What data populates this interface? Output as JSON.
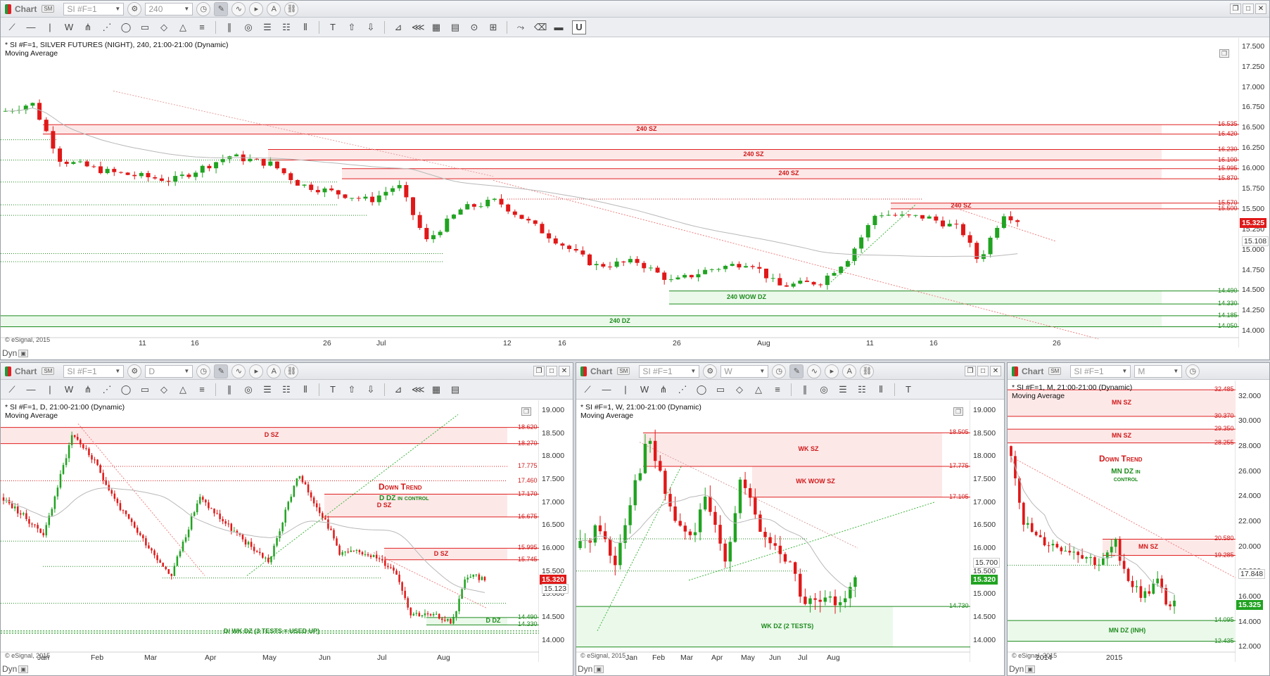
{
  "common": {
    "window_title": "Chart",
    "sync_label": "SM",
    "symbol": "SI #F=1",
    "dyn_label": "Dyn",
    "copyright": "© eSignal, 2015",
    "study": "Moving Average",
    "colors": {
      "supply": "#e02020",
      "demand": "#1d8a1d",
      "supply_fill": "#fde6e6",
      "demand_fill": "#e9f8e9"
    }
  },
  "win1": {
    "interval": "240",
    "header": "* SI #F=1, SILVER FUTURES (NIGHT), 240, 21:00-21:00 (Dynamic)",
    "price_axis": [
      "17.500",
      "17.250",
      "17.000",
      "16.750",
      "16.500",
      "16.250",
      "16.000",
      "15.750",
      "15.500",
      "15.250",
      "15.000",
      "14.750",
      "14.500",
      "14.250",
      "14.000"
    ],
    "levels": [
      "16.535",
      "16.420",
      "16.230",
      "16.100",
      "15.995",
      "15.870",
      "15.570",
      "15.500",
      "14.490",
      "14.330",
      "14.185",
      "14.050"
    ],
    "last_price": "15.325",
    "ma_value": "15.108",
    "time_axis": [
      "11",
      "16",
      "26",
      "Jul",
      "12",
      "16",
      "26",
      "Aug",
      "11",
      "16",
      "26"
    ],
    "zones": [
      "240 SZ",
      "240 SZ",
      "240 SZ",
      "240 SZ",
      "240 WOW DZ",
      "240 DZ"
    ]
  },
  "win2": {
    "interval": "D",
    "header": "* SI #F=1, D, 21:00-21:00 (Dynamic)",
    "price_axis": [
      "19.000",
      "18.500",
      "18.000",
      "17.500",
      "17.000",
      "16.500",
      "16.000",
      "15.500",
      "15.000",
      "14.500",
      "14.000"
    ],
    "levels": [
      "18.620",
      "18.270",
      "17.775",
      "17.460",
      "17.170",
      "16.675",
      "15.995",
      "15.745",
      "14.490",
      "14.330"
    ],
    "last_price": "15.320",
    "ma_value": "15.123",
    "time_axis": [
      "Jan",
      "Feb",
      "Mar",
      "Apr",
      "May",
      "Jun",
      "Jul",
      "Aug"
    ],
    "zones": [
      "D SZ",
      "D SZ",
      "D SZ",
      "D DZ",
      "D/ WK DZ (3 TESTS = USED UP)"
    ],
    "trend_title": "Down Trend",
    "trend_note": "D DZ in control"
  },
  "win3": {
    "interval": "W",
    "header": "* SI #F=1, W, 21:00-21:00 (Dynamic)",
    "price_axis": [
      "19.000",
      "18.500",
      "18.000",
      "17.500",
      "17.000",
      "16.500",
      "16.000",
      "15.500",
      "15.000",
      "14.500",
      "14.000"
    ],
    "levels": [
      "18.505",
      "17.775",
      "17.105",
      "14.730"
    ],
    "last_price": "15.320",
    "ma_value": "15.700",
    "time_axis": [
      "Jan",
      "Feb",
      "Mar",
      "Apr",
      "May",
      "Jun",
      "Jul",
      "Aug"
    ],
    "zones": [
      "WK SZ",
      "WK WOW SZ",
      "WK DZ (2 TESTS)"
    ]
  },
  "win4": {
    "interval": "M",
    "header": "* SI #F=1, M, 21:00-21:00 (Dynamic)",
    "price_axis": [
      "32.000",
      "30.000",
      "28.000",
      "26.000",
      "24.000",
      "22.000",
      "20.000",
      "18.000",
      "16.000",
      "14.000",
      "12.000"
    ],
    "levels": [
      "32.485",
      "30.370",
      "29.350",
      "28.255",
      "20.580",
      "19.285",
      "14.095",
      "12.435"
    ],
    "last_price": "15.325",
    "ma_value": "17.848",
    "time_axis": [
      "2014",
      "2015"
    ],
    "zones": [
      "MN SZ",
      "MN SZ",
      "MN SZ",
      "MN DZ (INH)"
    ],
    "trend_title": "Down Trend",
    "trend_note_1": "MN DZ in",
    "trend_note_2": "control"
  }
}
